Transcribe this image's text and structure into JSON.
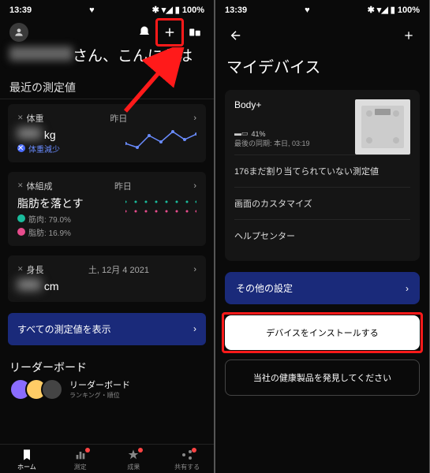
{
  "status": {
    "time": "13:39",
    "battery": "100%"
  },
  "left": {
    "greeting_suffix": "さん、こんにちは",
    "recent_title": "最近の測定値",
    "weight": {
      "label": "体重",
      "when": "昨日",
      "unit": "kg",
      "trend_label": "体重減少"
    },
    "body_comp": {
      "label": "体組成",
      "when": "昨日",
      "headline": "脂肪を落とす",
      "muscle_label": "筋肉",
      "muscle_val": "79.0%",
      "fat_label": "脂肪",
      "fat_val": "16.9%"
    },
    "height": {
      "label": "身長",
      "when": "土, 12月 4 2021",
      "unit": "cm"
    },
    "view_all": "すべての測定値を表示",
    "leaderboard_title": "リーダーボード",
    "leaderboard_item": "リーダーボード",
    "leaderboard_sub": "ランキング・順位",
    "tabs": [
      {
        "label": "ホーム"
      },
      {
        "label": "測定"
      },
      {
        "label": "成果"
      },
      {
        "label": "共有する"
      }
    ]
  },
  "right": {
    "page_title": "マイデバイス",
    "device": {
      "name": "Body+",
      "battery": "41%",
      "last_sync": "最後の同期: 本日, 03:19",
      "items": [
        "176まだ割り当てられていない測定値",
        "画面のカスタマイズ",
        "ヘルプセンター"
      ]
    },
    "other_settings": "その他の設定",
    "install": "デバイスをインストールする",
    "discover": "当社の健康製品を発見してください"
  }
}
